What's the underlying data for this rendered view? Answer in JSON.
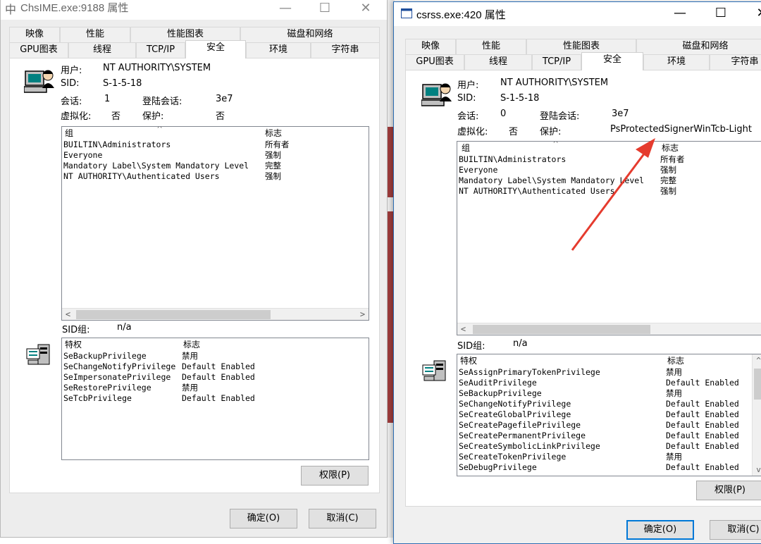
{
  "left_window": {
    "title": "ChsIME.exe:9188 属性",
    "title_icon": "中",
    "tabs_row1": [
      "映像",
      "性能",
      "性能图表",
      "磁盘和网络"
    ],
    "tabs_row2": [
      "GPU图表",
      "线程",
      "TCP/IP",
      "安全",
      "环境",
      "字符串"
    ],
    "active_tab": "安全",
    "user_label": "用户:",
    "user_value": "NT AUTHORITY\\SYSTEM",
    "sid_label": "SID:",
    "sid_value": "S-1-5-18",
    "session_label": "会话:",
    "session_value": "1",
    "logon_label": "登陆会话:",
    "logon_value": "3e7",
    "virt_label": "虚拟化:",
    "virt_value": "否",
    "protect_label": "保护:",
    "protect_value": "否",
    "groups_header": [
      "组",
      "标志"
    ],
    "groups": [
      {
        "name": "BUILTIN\\Administrators",
        "flag": "所有者"
      },
      {
        "name": "Everyone",
        "flag": "强制"
      },
      {
        "name": "Mandatory Label\\System Mandatory Level",
        "flag": "完整"
      },
      {
        "name": "NT AUTHORITY\\Authenticated Users",
        "flag": "强制"
      }
    ],
    "sidgroup_label": "SID组:",
    "sidgroup_value": "n/a",
    "privs_header": [
      "特权",
      "标志"
    ],
    "privileges": [
      {
        "name": "SeBackupPrivilege",
        "flag": "禁用"
      },
      {
        "name": "SeChangeNotifyPrivilege",
        "flag": "Default Enabled"
      },
      {
        "name": "SeImpersonatePrivilege",
        "flag": "Default Enabled"
      },
      {
        "name": "SeRestorePrivilege",
        "flag": "禁用"
      },
      {
        "name": "SeTcbPrivilege",
        "flag": "Default Enabled"
      }
    ],
    "perm_button": "权限(P)",
    "ok_button": "确定(O)",
    "cancel_button": "取消(C)"
  },
  "right_window": {
    "title": "csrss.exe:420 属性",
    "tabs_row1": [
      "映像",
      "性能",
      "性能图表",
      "磁盘和网络"
    ],
    "tabs_row2": [
      "GPU图表",
      "线程",
      "TCP/IP",
      "安全",
      "环境",
      "字符串"
    ],
    "active_tab": "安全",
    "user_label": "用户:",
    "user_value": "NT AUTHORITY\\SYSTEM",
    "sid_label": "SID:",
    "sid_value": "S-1-5-18",
    "session_label": "会话:",
    "session_value": "0",
    "logon_label": "登陆会话:",
    "logon_value": "3e7",
    "virt_label": "虚拟化:",
    "virt_value": "否",
    "protect_label": "保护:",
    "protect_value": "PsProtectedSignerWinTcb-Light",
    "groups_header": [
      "组",
      "标志"
    ],
    "groups": [
      {
        "name": "BUILTIN\\Administrators",
        "flag": "所有者"
      },
      {
        "name": "Everyone",
        "flag": "强制"
      },
      {
        "name": "Mandatory Label\\System Mandatory Level",
        "flag": "完整"
      },
      {
        "name": "NT AUTHORITY\\Authenticated Users",
        "flag": "强制"
      }
    ],
    "sidgroup_label": "SID组:",
    "sidgroup_value": "n/a",
    "privs_header": [
      "特权",
      "标志"
    ],
    "privileges": [
      {
        "name": "SeAssignPrimaryTokenPrivilege",
        "flag": "禁用"
      },
      {
        "name": "SeAuditPrivilege",
        "flag": "Default Enabled"
      },
      {
        "name": "SeBackupPrivilege",
        "flag": "禁用"
      },
      {
        "name": "SeChangeNotifyPrivilege",
        "flag": "Default Enabled"
      },
      {
        "name": "SeCreateGlobalPrivilege",
        "flag": "Default Enabled"
      },
      {
        "name": "SeCreatePagefilePrivilege",
        "flag": "Default Enabled"
      },
      {
        "name": "SeCreatePermanentPrivilege",
        "flag": "Default Enabled"
      },
      {
        "name": "SeCreateSymbolicLinkPrivilege",
        "flag": "Default Enabled"
      },
      {
        "name": "SeCreateTokenPrivilege",
        "flag": "禁用"
      },
      {
        "name": "SeDebugPrivilege",
        "flag": "Default Enabled"
      }
    ],
    "perm_button": "权限(P)",
    "ok_button": "确定(O)",
    "cancel_button": "取消(C)"
  },
  "colors": {
    "arrow": "#e53b2e",
    "focus_border": "#0078d7",
    "backdrop_red": "#9c3b3b"
  }
}
